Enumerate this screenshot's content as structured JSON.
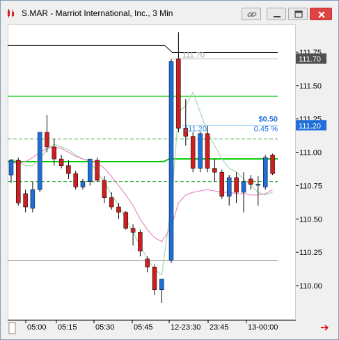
{
  "window": {
    "title": "S.MAR - Marriot International, Inc., 3 Min",
    "icons": {
      "app": "candlestick-app-icon",
      "link": "link-icon",
      "minimize": "minimize-icon",
      "restore": "restore-icon",
      "close": "close-icon"
    }
  },
  "price_axis": {
    "ticks": [
      "111.75",
      "111.50",
      "111.25",
      "111.00",
      "110.75",
      "110.50",
      "110.25",
      "110.00"
    ],
    "tick_values": [
      111.75,
      111.5,
      111.25,
      111.0,
      110.75,
      110.5,
      110.25,
      110.0
    ],
    "marker_high": "111.70",
    "marker_last": "111.20"
  },
  "time_axis": {
    "labels": [
      "05:00",
      "05:15",
      "05:30",
      "05:45",
      "12-23:30",
      "23:45",
      "13-00:00"
    ]
  },
  "annotations": {
    "high_label": "111.70",
    "last_label": "111.20",
    "change_value": "$0.50",
    "change_percent": "0.45 %"
  },
  "footer": {
    "arrow_icon": "scroll-right-arrow-icon"
  },
  "colors": {
    "up": "#1e6fd9",
    "down": "#cc1f1f",
    "green_line": "#00cc00",
    "light_green": "#a8d8a8",
    "pink": "#e88ac8",
    "price_box_dark": "#505050",
    "price_box_blue": "#1e6fd9"
  },
  "chart_data": {
    "type": "candlestick",
    "levels": {
      "upper_black": 111.8,
      "lower_black": 110.19,
      "green_solid": 110.95,
      "green_dashed_upper": 111.1,
      "green_dashed_lower": 110.78,
      "green_top": 111.42,
      "light_blue": 111.2,
      "gray_high": 111.7
    },
    "candles": [
      {
        "o": 110.83,
        "h": 110.95,
        "l": 110.77,
        "c": 110.94
      },
      {
        "o": 110.94,
        "h": 110.96,
        "l": 110.6,
        "c": 110.62
      },
      {
        "o": 110.69,
        "h": 110.72,
        "l": 110.55,
        "c": 110.59
      },
      {
        "o": 110.58,
        "h": 110.78,
        "l": 110.55,
        "c": 110.72
      },
      {
        "o": 110.72,
        "h": 111.15,
        "l": 110.7,
        "c": 111.15
      },
      {
        "o": 111.15,
        "h": 111.28,
        "l": 111.0,
        "c": 111.04
      },
      {
        "o": 111.04,
        "h": 111.1,
        "l": 110.9,
        "c": 110.95
      },
      {
        "o": 110.95,
        "h": 110.98,
        "l": 110.88,
        "c": 110.9
      },
      {
        "o": 110.9,
        "h": 110.94,
        "l": 110.8,
        "c": 110.84
      },
      {
        "o": 110.84,
        "h": 110.86,
        "l": 110.72,
        "c": 110.74
      },
      {
        "o": 110.74,
        "h": 110.8,
        "l": 110.72,
        "c": 110.78
      },
      {
        "o": 110.78,
        "h": 110.95,
        "l": 110.75,
        "c": 110.95
      },
      {
        "o": 110.94,
        "h": 110.96,
        "l": 110.78,
        "c": 110.79
      },
      {
        "o": 110.79,
        "h": 110.82,
        "l": 110.62,
        "c": 110.66
      },
      {
        "o": 110.66,
        "h": 110.7,
        "l": 110.57,
        "c": 110.59
      },
      {
        "o": 110.59,
        "h": 110.62,
        "l": 110.5,
        "c": 110.55
      },
      {
        "o": 110.55,
        "h": 110.56,
        "l": 110.42,
        "c": 110.43
      },
      {
        "o": 110.43,
        "h": 110.46,
        "l": 110.3,
        "c": 110.4
      },
      {
        "o": 110.4,
        "h": 110.42,
        "l": 110.22,
        "c": 110.26
      },
      {
        "o": 110.2,
        "h": 110.22,
        "l": 110.1,
        "c": 110.14
      },
      {
        "o": 110.14,
        "h": 110.16,
        "l": 109.93,
        "c": 109.97
      },
      {
        "o": 109.97,
        "h": 110.05,
        "l": 109.87,
        "c": 110.05
      },
      {
        "o": 110.19,
        "h": 111.7,
        "l": 110.17,
        "c": 111.68
      },
      {
        "o": 111.7,
        "h": 111.9,
        "l": 111.15,
        "c": 111.18
      },
      {
        "o": 111.18,
        "h": 111.4,
        "l": 111.05,
        "c": 111.12
      },
      {
        "o": 111.12,
        "h": 111.15,
        "l": 110.85,
        "c": 110.88
      },
      {
        "o": 110.88,
        "h": 111.15,
        "l": 110.85,
        "c": 111.14
      },
      {
        "o": 111.14,
        "h": 111.2,
        "l": 110.85,
        "c": 110.88
      },
      {
        "o": 110.88,
        "h": 110.95,
        "l": 110.78,
        "c": 110.85
      },
      {
        "o": 110.85,
        "h": 110.87,
        "l": 110.65,
        "c": 110.67
      },
      {
        "o": 110.67,
        "h": 110.83,
        "l": 110.6,
        "c": 110.81
      },
      {
        "o": 110.81,
        "h": 110.85,
        "l": 110.62,
        "c": 110.7
      },
      {
        "o": 110.7,
        "h": 110.85,
        "l": 110.55,
        "c": 110.78
      },
      {
        "o": 110.8,
        "h": 110.83,
        "l": 110.72,
        "c": 110.76
      },
      {
        "o": 110.76,
        "h": 110.82,
        "l": 110.6,
        "c": 110.76
      },
      {
        "o": 110.74,
        "h": 110.98,
        "l": 110.72,
        "c": 110.96
      },
      {
        "o": 110.98,
        "h": 110.99,
        "l": 110.83,
        "c": 110.84
      }
    ],
    "ma_light_green": [
      110.95,
      110.93,
      110.9,
      110.9,
      110.95,
      111.02,
      111.06,
      111.04,
      111.02,
      110.98,
      110.95,
      110.93,
      110.85,
      110.78,
      110.68,
      110.6,
      110.5,
      110.4,
      110.3,
      110.2,
      110.12,
      110.08,
      110.6,
      111.3,
      111.35,
      111.45,
      111.3,
      111.15,
      111.05,
      110.95,
      110.88,
      110.85,
      110.8,
      110.75,
      110.7,
      110.68,
      110.7
    ],
    "ma_pink": [
      110.92,
      110.92,
      110.93,
      110.96,
      111.0,
      111.03,
      111.04,
      111.03,
      111.0,
      110.97,
      110.95,
      110.94,
      110.92,
      110.88,
      110.82,
      110.75,
      110.68,
      110.6,
      110.5,
      110.42,
      110.36,
      110.33,
      110.44,
      110.62,
      110.68,
      110.7,
      110.71,
      110.72,
      110.71,
      110.7,
      110.7,
      110.69,
      110.69,
      110.68,
      110.68,
      110.69,
      110.72
    ]
  }
}
